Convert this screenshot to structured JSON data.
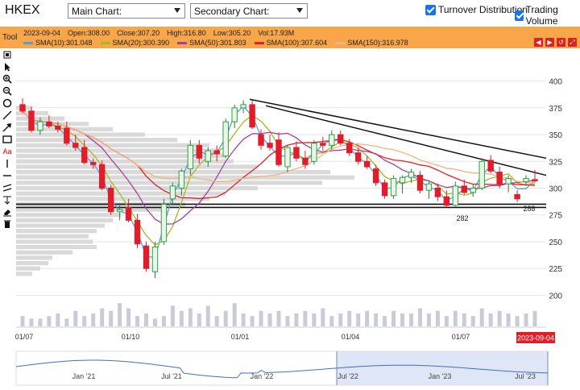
{
  "header": {
    "ticker": "HKEX",
    "main_chart_select": "Main Chart:",
    "secondary_chart_select": "Secondary Chart:",
    "turnover_distribution": "Turnover Distribution",
    "trading_volume": "Trading Volume"
  },
  "info": {
    "tool_label": "Tool",
    "date": "2023-09-04",
    "open": "Open:308.00",
    "close": "Close:307.20",
    "high": "High:316.80",
    "low": "Low:305.20",
    "vol": "Vol:17.93M",
    "sma": [
      {
        "label": "SMA(10):301.048",
        "color": "#5b9bd5"
      },
      {
        "label": "SMA(20):300.390",
        "color": "#a8b820"
      },
      {
        "label": "SMA(50):301.803",
        "color": "#a040a0"
      },
      {
        "label": "SMA(100):307.604",
        "color": "#e0202a"
      },
      {
        "label": "SMA(150):316.978",
        "color": "#f5b27a"
      }
    ]
  },
  "toolbar_icons": [
    "pointer-icon",
    "crosshair-icon",
    "zoom-in-icon",
    "zoom-out-icon",
    "circle-icon",
    "line-icon",
    "arrow-icon",
    "rectangle-icon",
    "text-icon",
    "vertical-line-icon",
    "horizontal-line-icon",
    "parallel-lines-icon",
    "fibonacci-icon",
    "eraser-icon",
    "trash-icon"
  ],
  "text_tool_label": "Aa",
  "chart_data": {
    "type": "candlestick",
    "y_ticks": [
      200,
      225,
      250,
      275,
      300,
      325,
      350,
      375,
      400
    ],
    "ylim": [
      186,
      408
    ],
    "x_labels": [
      "01/07",
      "01/10",
      "01/01",
      "01/04",
      "01/07"
    ],
    "last_date_label": "2023-09-04",
    "annotations": [
      "282",
      "288"
    ],
    "support_levels": [
      285,
      282
    ],
    "trendlines": [
      [
        383,
        328
      ],
      [
        377,
        312
      ]
    ],
    "volume_bars": [
      4,
      3,
      3,
      4,
      5,
      3,
      6,
      4,
      5,
      7,
      6,
      9,
      7,
      4,
      5,
      3,
      4,
      8,
      6,
      7,
      5,
      8,
      4,
      6,
      9,
      5,
      4,
      6,
      5,
      6,
      4,
      5,
      6,
      5,
      7,
      4,
      5,
      6,
      5,
      6,
      5,
      4,
      6,
      5,
      5,
      7,
      5,
      6,
      4,
      6,
      5,
      4,
      7,
      5,
      6,
      5,
      4,
      5,
      6
    ],
    "candles": [
      {
        "o": 378,
        "h": 384,
        "l": 370,
        "c": 372
      },
      {
        "o": 372,
        "h": 376,
        "l": 352,
        "c": 354
      },
      {
        "o": 354,
        "h": 366,
        "l": 350,
        "c": 362
      },
      {
        "o": 362,
        "h": 368,
        "l": 356,
        "c": 358
      },
      {
        "o": 358,
        "h": 362,
        "l": 352,
        "c": 355
      },
      {
        "o": 356,
        "h": 362,
        "l": 340,
        "c": 342
      },
      {
        "o": 342,
        "h": 350,
        "l": 335,
        "c": 338
      },
      {
        "o": 338,
        "h": 345,
        "l": 322,
        "c": 324
      },
      {
        "o": 324,
        "h": 328,
        "l": 318,
        "c": 322
      },
      {
        "o": 322,
        "h": 326,
        "l": 298,
        "c": 300
      },
      {
        "o": 300,
        "h": 303,
        "l": 275,
        "c": 278
      },
      {
        "o": 278,
        "h": 285,
        "l": 270,
        "c": 280
      },
      {
        "o": 282,
        "h": 290,
        "l": 268,
        "c": 270
      },
      {
        "o": 270,
        "h": 276,
        "l": 244,
        "c": 248
      },
      {
        "o": 246,
        "h": 250,
        "l": 222,
        "c": 225
      },
      {
        "o": 222,
        "h": 250,
        "l": 216,
        "c": 245
      },
      {
        "o": 250,
        "h": 290,
        "l": 247,
        "c": 285
      },
      {
        "o": 290,
        "h": 305,
        "l": 285,
        "c": 302
      },
      {
        "o": 300,
        "h": 318,
        "l": 293,
        "c": 316
      },
      {
        "o": 318,
        "h": 345,
        "l": 312,
        "c": 340
      },
      {
        "o": 340,
        "h": 345,
        "l": 323,
        "c": 328
      },
      {
        "o": 325,
        "h": 338,
        "l": 320,
        "c": 335
      },
      {
        "o": 335,
        "h": 340,
        "l": 325,
        "c": 332
      },
      {
        "o": 330,
        "h": 365,
        "l": 328,
        "c": 362
      },
      {
        "o": 362,
        "h": 378,
        "l": 356,
        "c": 375
      },
      {
        "o": 375,
        "h": 382,
        "l": 370,
        "c": 378
      },
      {
        "o": 378,
        "h": 382,
        "l": 355,
        "c": 357
      },
      {
        "o": 350,
        "h": 355,
        "l": 336,
        "c": 340
      },
      {
        "o": 342,
        "h": 350,
        "l": 335,
        "c": 338
      },
      {
        "o": 345,
        "h": 352,
        "l": 320,
        "c": 322
      },
      {
        "o": 320,
        "h": 340,
        "l": 315,
        "c": 338
      },
      {
        "o": 338,
        "h": 344,
        "l": 325,
        "c": 328
      },
      {
        "o": 328,
        "h": 335,
        "l": 318,
        "c": 322
      },
      {
        "o": 325,
        "h": 345,
        "l": 322,
        "c": 342
      },
      {
        "o": 342,
        "h": 348,
        "l": 335,
        "c": 340
      },
      {
        "o": 340,
        "h": 354,
        "l": 336,
        "c": 350
      },
      {
        "o": 350,
        "h": 354,
        "l": 340,
        "c": 342
      },
      {
        "o": 342,
        "h": 346,
        "l": 330,
        "c": 333
      },
      {
        "o": 333,
        "h": 338,
        "l": 322,
        "c": 325
      },
      {
        "o": 325,
        "h": 330,
        "l": 318,
        "c": 320
      },
      {
        "o": 318,
        "h": 322,
        "l": 302,
        "c": 305
      },
      {
        "o": 305,
        "h": 308,
        "l": 290,
        "c": 293
      },
      {
        "o": 293,
        "h": 312,
        "l": 290,
        "c": 309
      },
      {
        "o": 305,
        "h": 312,
        "l": 295,
        "c": 310
      },
      {
        "o": 310,
        "h": 318,
        "l": 305,
        "c": 315
      },
      {
        "o": 312,
        "h": 316,
        "l": 295,
        "c": 298
      },
      {
        "o": 298,
        "h": 306,
        "l": 290,
        "c": 304
      },
      {
        "o": 300,
        "h": 304,
        "l": 288,
        "c": 292
      },
      {
        "o": 292,
        "h": 298,
        "l": 282,
        "c": 284
      },
      {
        "o": 284,
        "h": 306,
        "l": 283,
        "c": 302
      },
      {
        "o": 302,
        "h": 308,
        "l": 294,
        "c": 296
      },
      {
        "o": 296,
        "h": 304,
        "l": 292,
        "c": 300
      },
      {
        "o": 300,
        "h": 328,
        "l": 298,
        "c": 325
      },
      {
        "o": 326,
        "h": 331,
        "l": 314,
        "c": 316
      },
      {
        "o": 315,
        "h": 320,
        "l": 300,
        "c": 304
      },
      {
        "o": 304,
        "h": 312,
        "l": 296,
        "c": 309
      },
      {
        "o": 294,
        "h": 298,
        "l": 287,
        "c": 290
      },
      {
        "o": 306,
        "h": 312,
        "l": 302,
        "c": 309
      },
      {
        "o": 308,
        "h": 317,
        "l": 305,
        "c": 307
      }
    ]
  },
  "navigator": {
    "labels": [
      "Jan '21",
      "Jul '21",
      "Jan '22",
      "Jul '22",
      "Jan '23",
      "Jul '23"
    ]
  }
}
